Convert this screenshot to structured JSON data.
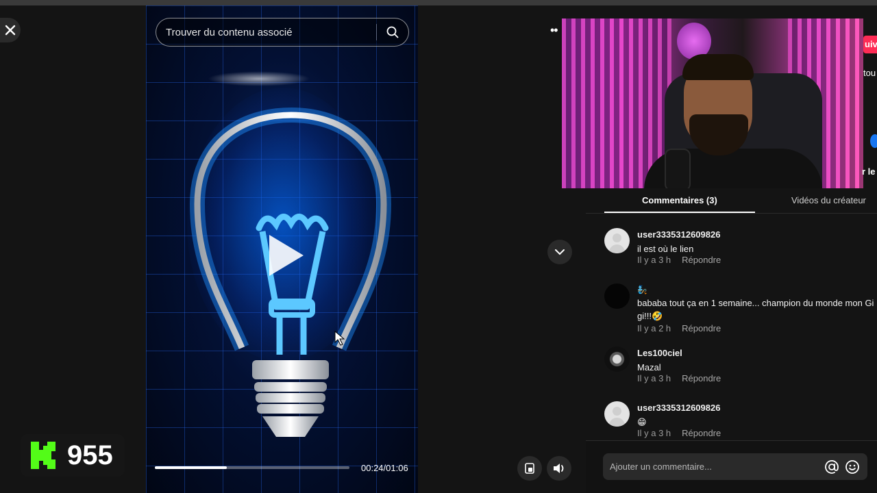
{
  "search": {
    "placeholder": "Trouver du contenu associé",
    "icon": "search-icon"
  },
  "player": {
    "current_time": "00:24",
    "duration": "01:06",
    "time_display": "00:24/01:06",
    "progress_fraction": 0.37
  },
  "badge": {
    "letter_icon": "kick-logo-icon",
    "count": "955",
    "color": "#53fc18"
  },
  "webcam_overlay": {
    "edge_text_top": "uiv",
    "edge_text_middle": "tou",
    "edge_text_bottom": "r le"
  },
  "tabs": [
    {
      "label": "Commentaires (3)",
      "active": true
    },
    {
      "label": "Vidéos du créateur",
      "active": false
    }
  ],
  "comments": [
    {
      "user": "user3335312609826",
      "text": "il est où le lien",
      "time": "Il y a 3 h",
      "reply": "Répondre",
      "avatar": "default-avatar"
    },
    {
      "user": "",
      "text": "bababa tout ça en 1 semaine... champion du monde mon Gi gi!!!🤣",
      "time": "Il y a 2 h",
      "reply": "Répondre",
      "avatar": "dark-avatar",
      "user_emoji": "🧞"
    },
    {
      "user": "Les100ciel",
      "text": "Mazal",
      "time": "Il y a 3 h",
      "reply": "Répondre",
      "avatar": "logo-avatar"
    },
    {
      "user": "user3335312609826",
      "text": "😁",
      "time": "Il y a 3 h",
      "reply": "Répondre",
      "avatar": "default-avatar"
    }
  ],
  "composer": {
    "placeholder": "Ajouter un commentaire..."
  },
  "colors": {
    "accent_pink": "#fe2c55",
    "bulb_blue": "#1e90ff",
    "background": "#121212"
  }
}
